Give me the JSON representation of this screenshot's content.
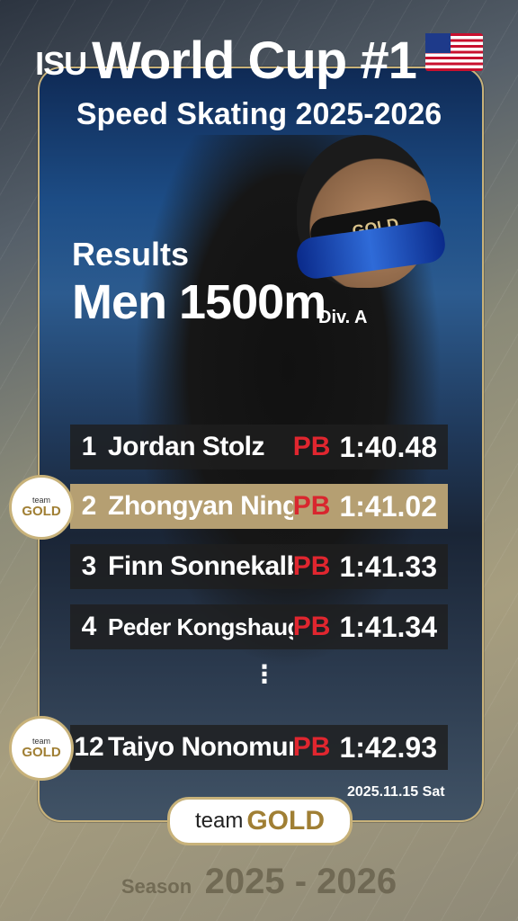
{
  "header": {
    "prefix": "ISU",
    "title": "World Cup #1",
    "subtitle": "Speed Skating 2025-2026",
    "flag_icon": "us-flag-icon"
  },
  "event": {
    "results_label": "Results",
    "name": "Men 1500m",
    "division": "Div. A"
  },
  "helmet_text": "GOLD",
  "results": [
    {
      "rank": "1",
      "name": "Jordan Stolz",
      "pb": "PB",
      "time": "1:40.48",
      "highlight": false
    },
    {
      "rank": "2",
      "name": "Zhongyan Ning",
      "pb": "PB",
      "time": "1:41.02",
      "highlight": true
    },
    {
      "rank": "3",
      "name": "Finn Sonnekalb",
      "pb": "PB",
      "time": "1:41.33",
      "highlight": false
    },
    {
      "rank": "4",
      "name": "Peder Kongshaug",
      "pb": "PB",
      "time": "1:41.34",
      "highlight": false
    },
    {
      "rank": "12",
      "name": "Taiyo Nonomura",
      "pb": "PB",
      "time": "1:42.93",
      "highlight": false
    }
  ],
  "ellipsis": "⋮",
  "badge": {
    "top": "team",
    "bottom": "GOLD"
  },
  "date": "2025.11.15 Sat",
  "footer_logo": {
    "team": "team",
    "gold": "GOLD"
  },
  "season": {
    "label": "Season",
    "years": "2025 - 2026"
  },
  "colors": {
    "accent_gold": "#c8b27a",
    "highlight_row": "#b59f72",
    "pb_red": "#e0262f"
  }
}
